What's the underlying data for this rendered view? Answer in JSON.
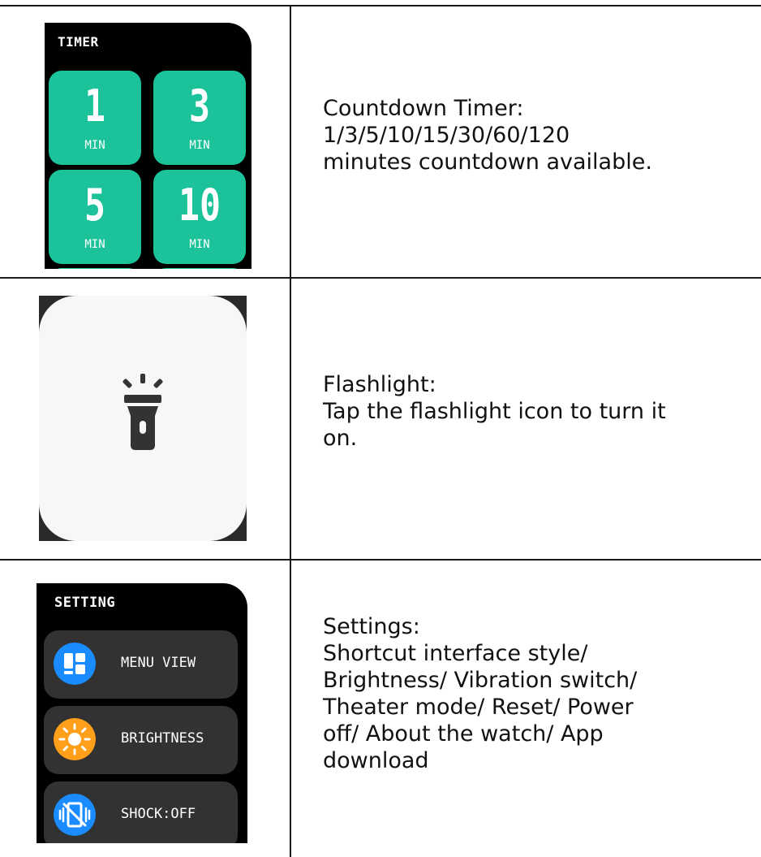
{
  "rows": [
    {
      "screen": {
        "title": "TIMER",
        "tiles": [
          {
            "value": "1",
            "unit": "MIN"
          },
          {
            "value": "3",
            "unit": "MIN"
          },
          {
            "value": "5",
            "unit": "MIN"
          },
          {
            "value": "10",
            "unit": "MIN"
          }
        ],
        "accent_color": "#1cc39a"
      },
      "description": [
        "Countdown Timer:",
        "1/3/5/10/15/30/60/120",
        "minutes countdown available."
      ]
    },
    {
      "screen": {
        "icon": "flashlight-icon"
      },
      "description": [
        "Flashlight:",
        "Tap the flashlight icon to turn it",
        "on."
      ]
    },
    {
      "screen": {
        "title": "SETTING",
        "items": [
          {
            "label": "MENU VIEW",
            "icon": "menu-view-icon",
            "icon_color": "#1a8cff"
          },
          {
            "label": "BRIGHTNESS",
            "icon": "brightness-icon",
            "icon_color": "#ff9f1a"
          },
          {
            "label": "SHOCK:OFF",
            "icon": "vibration-off-icon",
            "icon_color": "#1a8cff"
          }
        ]
      },
      "description": [
        "Settings:",
        "Shortcut interface style/",
        "Brightness/ Vibration switch/",
        "Theater mode/ Reset/ Power",
        "off/ About the watch/ App",
        "download"
      ]
    }
  ]
}
